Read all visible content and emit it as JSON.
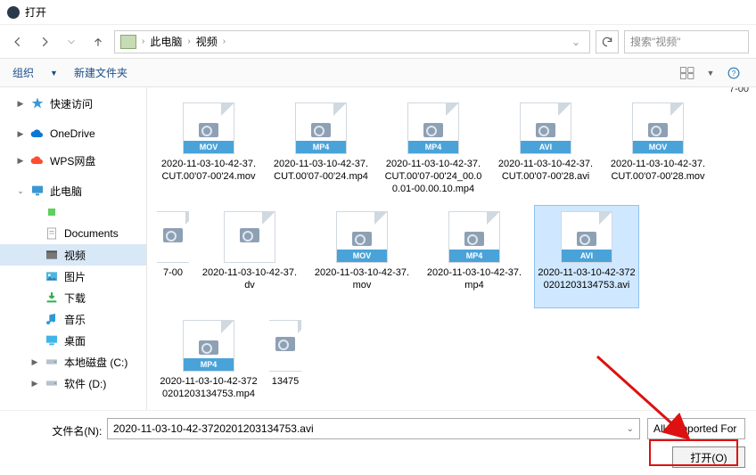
{
  "title": "打开",
  "breadcrumbs": {
    "root": "此电脑",
    "folder": "视频"
  },
  "search_placeholder": "搜索\"视频\"",
  "toolbar": {
    "organize": "组织",
    "new_folder": "新建文件夹"
  },
  "sidebar": {
    "quick": "快速访问",
    "onedrive": "OneDrive",
    "wps": "WPS网盘",
    "pc": "此电脑",
    "documents": "Documents",
    "videos": "视频",
    "pictures": "图片",
    "downloads": "下载",
    "music": "音乐",
    "desktop": "桌面",
    "drive_c": "本地磁盘 (C:)",
    "drive_d": "软件 (D:)"
  },
  "truncated_top": "7-00",
  "files": [
    {
      "name": "2020-11-03-10-42-37.CUT.00'07-00'24.mov",
      "badge": "MOV",
      "sel": false
    },
    {
      "name": "2020-11-03-10-42-37.CUT.00'07-00'24.mp4",
      "badge": "MP4",
      "sel": false
    },
    {
      "name": "2020-11-03-10-42-37.CUT.00'07-00'24_00.00.01-00.00.10.mp4",
      "badge": "MP4",
      "sel": false
    },
    {
      "name": "2020-11-03-10-42-37.CUT.00'07-00'28.avi",
      "badge": "AVI",
      "sel": false
    },
    {
      "name": "2020-11-03-10-42-37.CUT.00'07-00'28.mov",
      "badge": "MOV",
      "sel": false
    },
    {
      "name": "7-00",
      "badge": "",
      "sel": false,
      "half": true
    },
    {
      "name": "2020-11-03-10-42-37.dv",
      "badge": "",
      "sel": false
    },
    {
      "name": "2020-11-03-10-42-37.mov",
      "badge": "MOV",
      "sel": false
    },
    {
      "name": "2020-11-03-10-42-37.mp4",
      "badge": "MP4",
      "sel": false
    },
    {
      "name": "2020-11-03-10-42-3720201203134753.avi",
      "badge": "AVI",
      "sel": true
    },
    {
      "name": "2020-11-03-10-42-3720201203134753.mp4",
      "badge": "MP4",
      "sel": false
    },
    {
      "name": "13475",
      "badge": "",
      "sel": false,
      "half": true
    }
  ],
  "filename_label": "文件名(N):",
  "filename_value": "2020-11-03-10-42-3720201203134753.avi",
  "filter_label": "All Supported For",
  "open_btn": "打开(O)"
}
